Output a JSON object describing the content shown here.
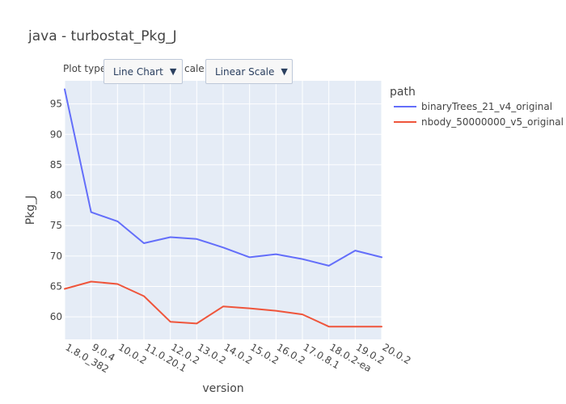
{
  "title": "java - turbostat_Pkg_J",
  "controls": {
    "plot_type_label": "Plot type",
    "plot_type_value": "Line Chart",
    "scale_label": "cale:",
    "scale_value": "Linear Scale",
    "dropdown_arrow": "▼"
  },
  "chart_data": {
    "type": "line",
    "xlabel": "version",
    "ylabel": "Pkg_J",
    "categories": [
      "1.8.0_382",
      "9.0.4",
      "10.0.2",
      "11.0.20.1",
      "12.0.2",
      "13.0.2",
      "14.0.2",
      "15.0.2",
      "16.0.2",
      "17.0.8.1",
      "18.0.2-ea",
      "19.0.2",
      "20.0.2"
    ],
    "ylim": [
      56.3,
      98.8
    ],
    "yticks": [
      60,
      65,
      70,
      75,
      80,
      85,
      90,
      95
    ],
    "grid": true,
    "legend_title": "path",
    "legend_position": "right",
    "background": "#e5ecf6",
    "series": [
      {
        "name": "binaryTrees_21_v4_original",
        "color": "#636efa",
        "values": [
          97.4,
          77.2,
          75.7,
          72.1,
          73.1,
          72.8,
          71.4,
          69.8,
          70.3,
          69.5,
          68.4,
          70.9,
          69.8
        ]
      },
      {
        "name": "nbody_50000000_v5_original",
        "color": "#ef553b",
        "values": [
          64.6,
          65.8,
          65.4,
          63.4,
          59.2,
          58.9,
          61.7,
          61.4,
          61.0,
          60.4,
          58.4,
          58.4,
          58.4
        ]
      }
    ]
  }
}
